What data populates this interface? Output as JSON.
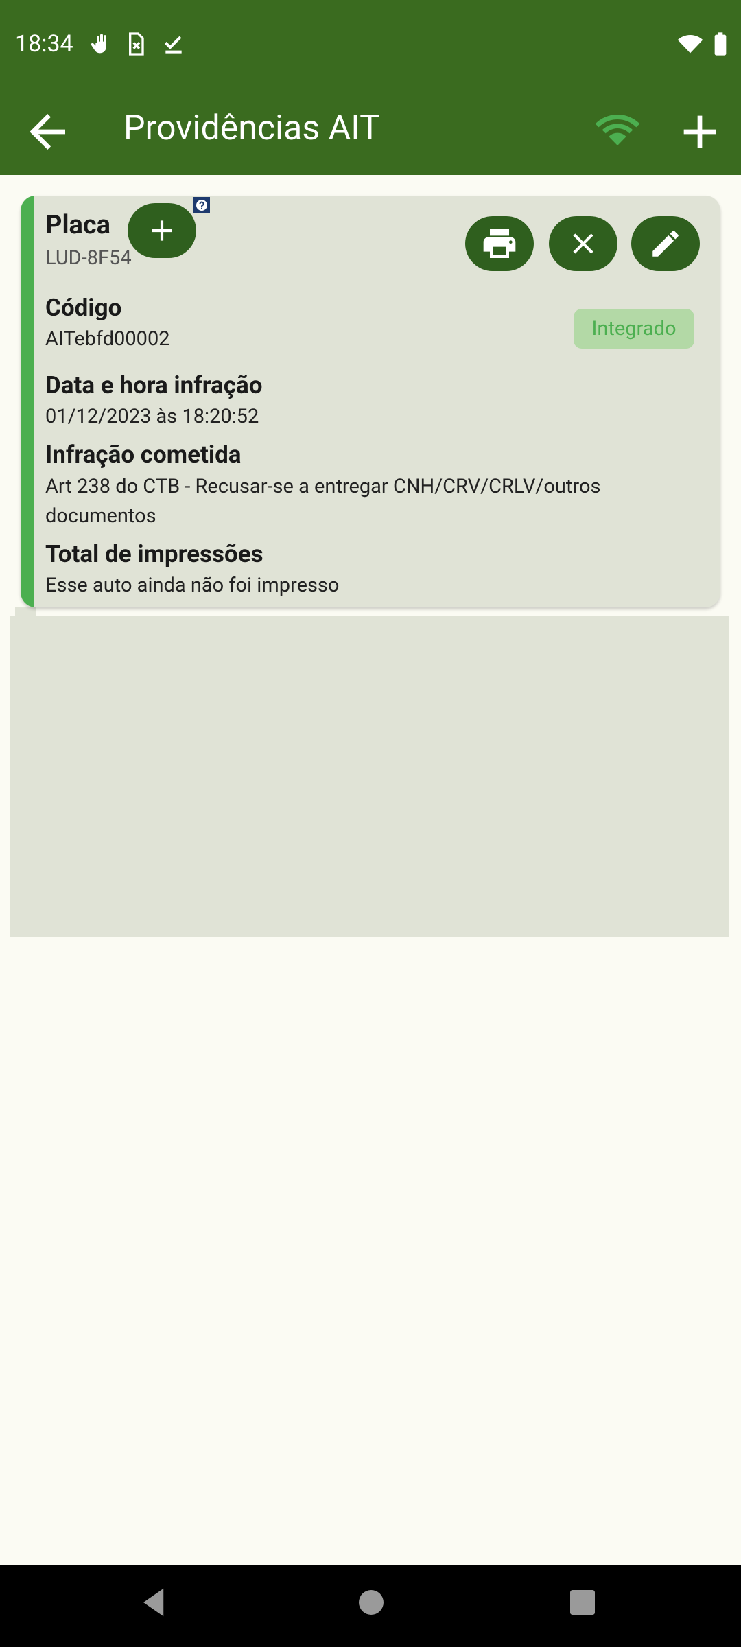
{
  "status_bar": {
    "time": "18:34",
    "icons": [
      "gesture-icon",
      "sim-error-icon",
      "check-icon",
      "wifi-icon",
      "battery-icon"
    ]
  },
  "app_bar": {
    "title": "Providências AIT",
    "back_icon": "arrow-back-icon",
    "wifi_icon": "wifi-icon",
    "add_icon": "add-icon",
    "colors": {
      "background": "#3a6b1f",
      "wifi_accent": "#4caf50"
    }
  },
  "card": {
    "placa_label": "Placa",
    "placa_value": "LUD-8F54",
    "codigo_label": "Código",
    "codigo_value": "AITebfd00002",
    "status_badge": "Integrado",
    "data_label": "Data e hora infração",
    "data_value": "01/12/2023 às 18:20:52",
    "infracao_label": "Infração cometida",
    "infracao_value": "Art 238 do CTB - Recusar-se a entregar CNH/CRV/CRLV/outros documentos",
    "impressoes_label": "Total de impressões",
    "impressoes_value": "Esse auto ainda não foi impresso",
    "actions": [
      "print-icon",
      "close-icon",
      "edit-icon"
    ],
    "colors": {
      "accent": "#4caf50",
      "button": "#2f5f1e",
      "badge_bg": "#b3d9a6",
      "card_bg": "#e0e3d6"
    }
  },
  "floating": {
    "add_icon": "add-icon",
    "help_icon": "help-icon"
  },
  "nav_bar": {
    "icons": [
      "nav-back-icon",
      "nav-home-icon",
      "nav-recents-icon"
    ]
  }
}
